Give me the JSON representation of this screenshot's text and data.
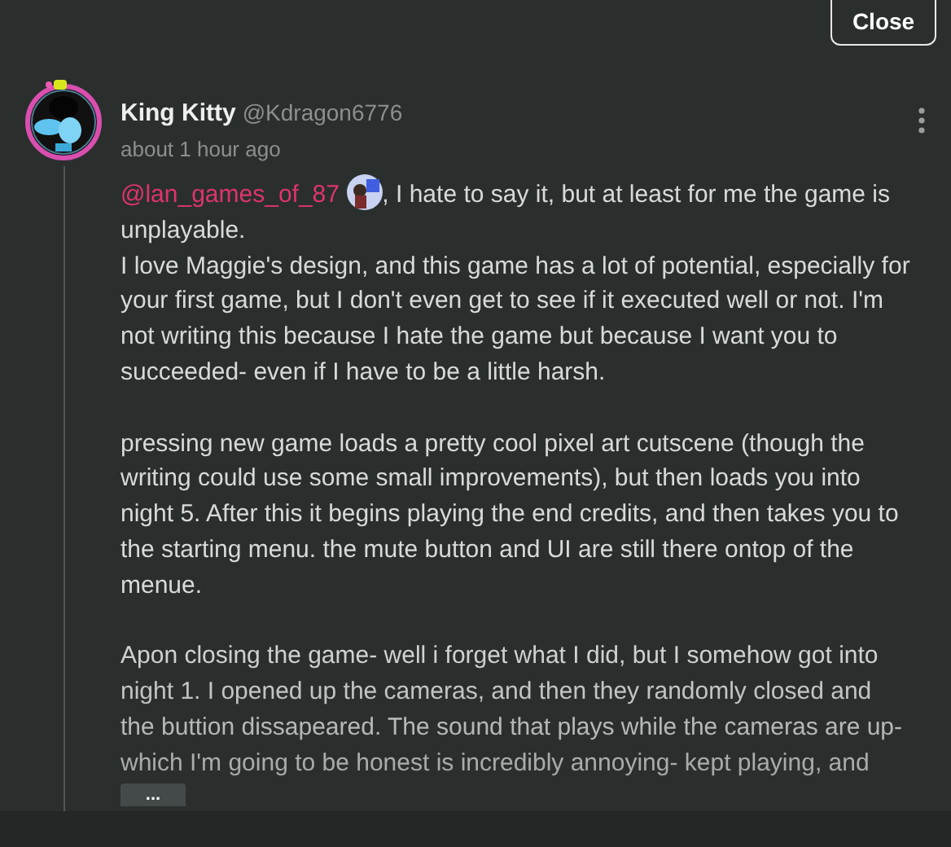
{
  "close_button": "Close",
  "comment": {
    "author": "King Kitty",
    "handle": "@Kdragon6776",
    "time": "about 1 hour ago",
    "paragraphs": [
      {
        "sentences": [
          {
            "mention": "@lan_games_of_87",
            "text": ", I hate to say it, but at least for me the game is unplayable."
          },
          {
            "text": "I love Maggie's design, and this game has a lot of potential, especially for your first game, but I don't even get to see if it executed well or not. I'm not writing this because I hate the game but because I want you to succeeded- even if I have to be a little harsh."
          }
        ]
      },
      {
        "sentences": [
          {
            "text": "pressing new game loads a pretty cool pixel art cutscene (though the writing could use some small improvements), but then loads you into night 5. After this it begins playing the end credits, and then takes you to the starting menu. the mute button and UI are still there ontop of the menue."
          }
        ]
      },
      {
        "sentences": [
          {
            "text": "Apon closing the game- well i forget what I did, but I somehow got into night 1. I opened up the cameras, and then they randomly closed and the buttion dissapeared. The sound that plays while the cameras are up- which I'm going to be honest is incredibly annoying- kept playing, and"
          }
        ]
      }
    ],
    "expand_button": "..."
  }
}
